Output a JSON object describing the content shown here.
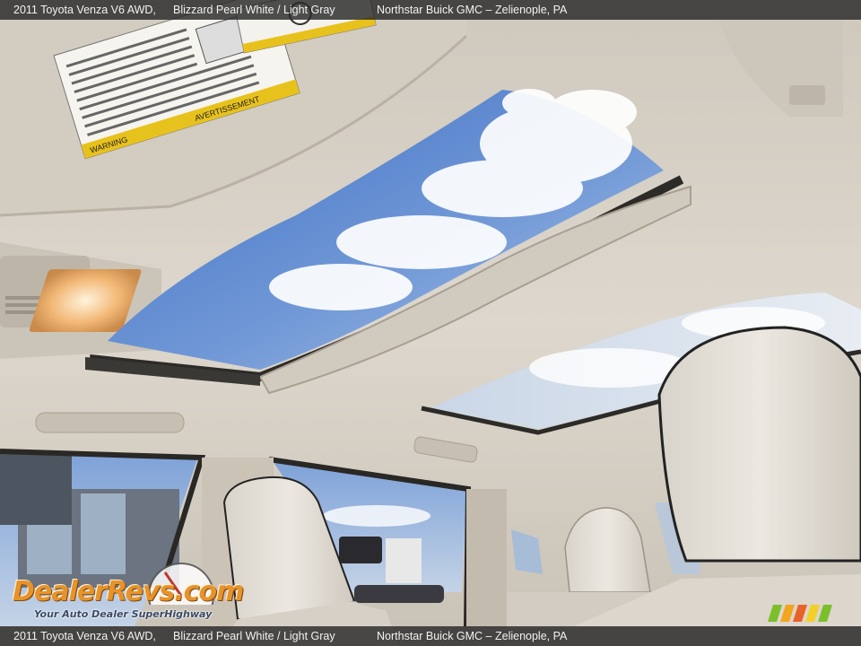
{
  "caption": {
    "model": "2011 Toyota Venza V6 AWD,",
    "color": "Blizzard Pearl White / Light Gray",
    "dealer": "Northstar Buick GMC – Zelienople, PA"
  },
  "watermark": {
    "brand": "DealerRevs.com",
    "tagline": "Your Auto Dealer SuperHighway"
  },
  "labels": {
    "warning_header": "WARNING",
    "warning_header_alt": "AVERTISSEMENT"
  },
  "colors": {
    "headliner": "#d9d3c9",
    "sky": "#5b86cf",
    "warning_yellow": "#e8c21c",
    "dome_light": "#f2b774",
    "watermark_orange": "#e8922a"
  },
  "icons": {
    "logo_stripes": "colored-stripes-logo"
  }
}
